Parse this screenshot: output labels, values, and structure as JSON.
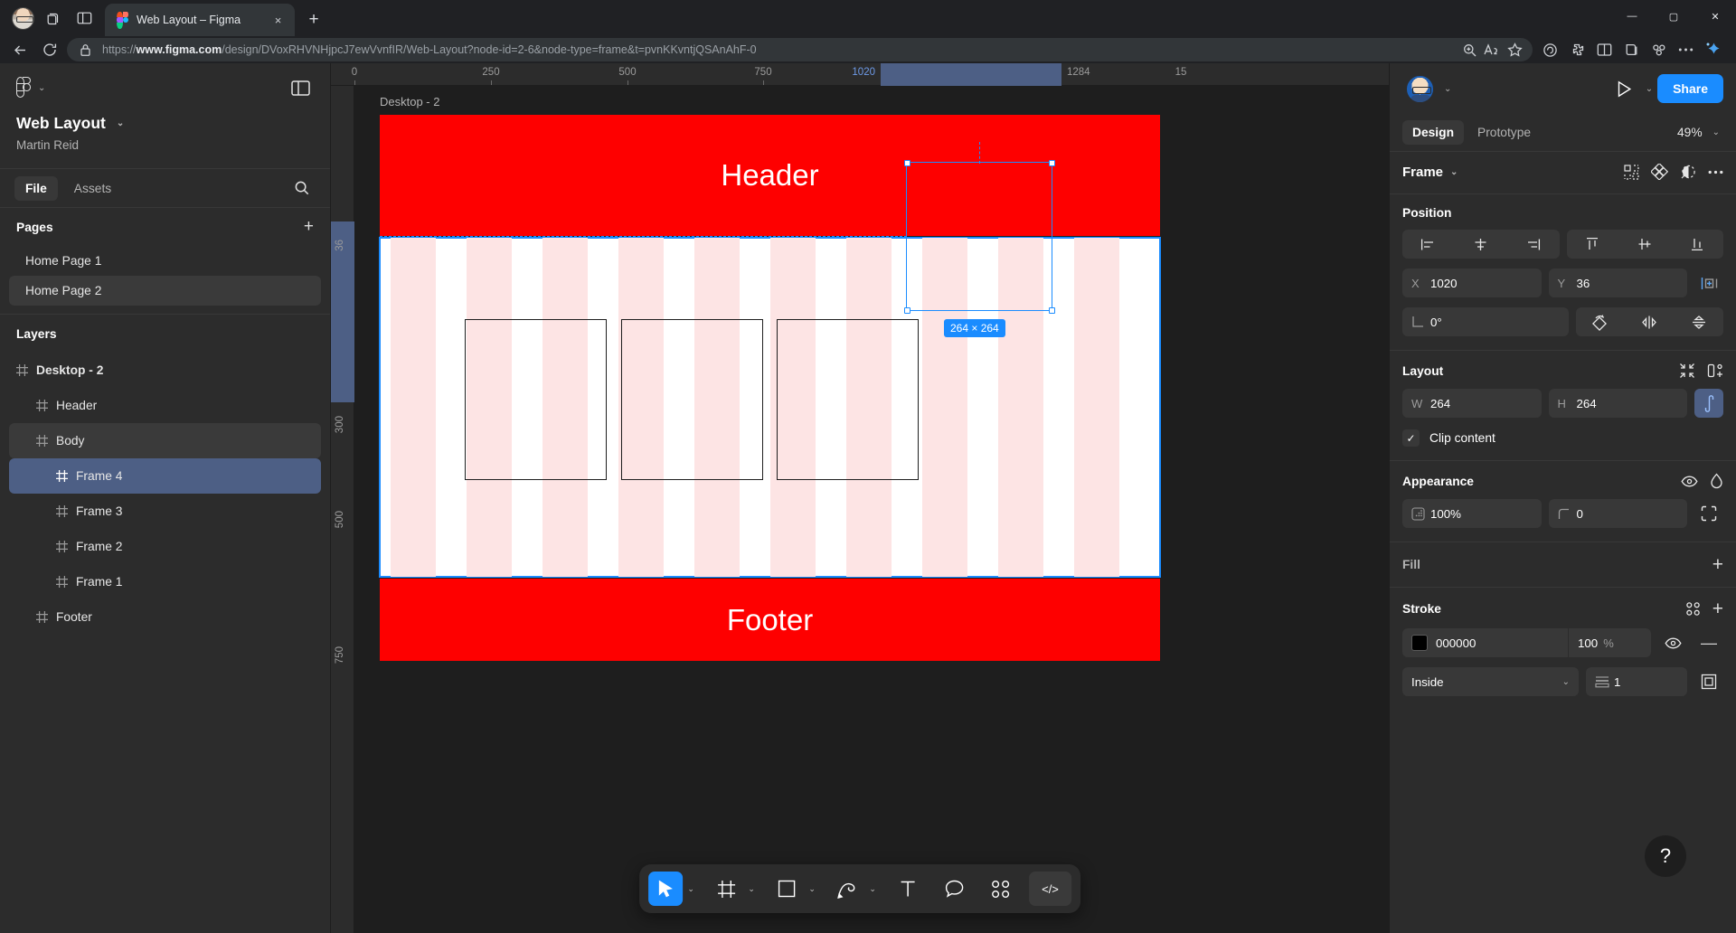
{
  "browser": {
    "tab": {
      "title": "Web Layout – Figma",
      "favicon": "figma-logo-icon",
      "close": "×"
    },
    "new_tab_label": "+",
    "window_controls": {
      "minimize": "—",
      "maximize": "▢",
      "close": "✕"
    },
    "address": {
      "url_prefix": "https://",
      "url_domain": "www.figma.com",
      "url_path": "/design/DVoxRHVNHjpcJ7ewVvnfIR/Web-Layout?node-id=2-6&node-type=frame&t=pvnKKvntjQSAnAhF-0",
      "lock_icon": "lock-icon"
    },
    "toolbar_icons": [
      "back-icon",
      "reload-icon",
      "zoom-icon",
      "read-aloud-icon",
      "favorite-icon",
      "collections-icon",
      "extensions-icon",
      "split-screen-icon",
      "browser-essentials-icon",
      "settings-more-icon",
      "copilot-icon"
    ]
  },
  "left_panel": {
    "file_name": "Web Layout",
    "file_owner": "Martin Reid",
    "tabs": [
      {
        "label": "File",
        "active": true
      },
      {
        "label": "Assets",
        "active": false
      }
    ],
    "search_icon": "search-icon",
    "pages_section": {
      "title": "Pages",
      "add_label": "+"
    },
    "pages": [
      {
        "label": "Home Page 1",
        "active": false
      },
      {
        "label": "Home Page 2",
        "active": true
      }
    ],
    "layers_section": {
      "title": "Layers"
    },
    "layers": [
      {
        "label": "Desktop - 2",
        "depth": 0,
        "state": "none",
        "bold": true
      },
      {
        "label": "Header",
        "depth": 1,
        "state": "none",
        "bold": false
      },
      {
        "label": "Body",
        "depth": 1,
        "state": "hovered",
        "bold": false
      },
      {
        "label": "Frame 4",
        "depth": 2,
        "state": "selected",
        "bold": false
      },
      {
        "label": "Frame 3",
        "depth": 2,
        "state": "none",
        "bold": false
      },
      {
        "label": "Frame 2",
        "depth": 2,
        "state": "none",
        "bold": false
      },
      {
        "label": "Frame 1",
        "depth": 2,
        "state": "none",
        "bold": false
      },
      {
        "label": "Footer",
        "depth": 1,
        "state": "none",
        "bold": false
      }
    ]
  },
  "canvas": {
    "frame_label": "Desktop - 2",
    "ruler_h": [
      {
        "label": "0",
        "pos": 0,
        "highlight": false
      },
      {
        "label": "250",
        "pos": 250,
        "highlight": false
      },
      {
        "label": "500",
        "pos": 500,
        "highlight": false
      },
      {
        "label": "750",
        "pos": 750,
        "highlight": false
      },
      {
        "label": "1020",
        "pos": 1020,
        "highlight": true
      },
      {
        "label": "1284",
        "pos": 1284,
        "highlight": false
      },
      {
        "label": "15",
        "pos": 1540,
        "highlight": false
      }
    ],
    "ruler_v": [
      {
        "label": "36",
        "pos": 36
      },
      {
        "label": "300",
        "pos": 300
      },
      {
        "label": "500",
        "pos": 500
      },
      {
        "label": "750",
        "pos": 750
      }
    ],
    "header_text": "Header",
    "footer_text": "Footer",
    "selection_badge": "264 × 264",
    "header_fill": "#fe0000",
    "footer_fill": "#fe0000",
    "grid_color": "#fde4e4",
    "selection_color": "#1a8cff"
  },
  "toolbar": {
    "tools": [
      {
        "name": "move-tool",
        "active": true,
        "has_caret": true
      },
      {
        "name": "frame-tool",
        "active": false,
        "has_caret": true
      },
      {
        "name": "shape-tool",
        "active": false,
        "has_caret": true
      },
      {
        "name": "pen-tool",
        "active": false,
        "has_caret": true
      },
      {
        "name": "text-tool",
        "active": false,
        "has_caret": false
      },
      {
        "name": "comment-tool",
        "active": false,
        "has_caret": false
      },
      {
        "name": "actions-tool",
        "active": false,
        "has_caret": false
      }
    ],
    "dev_mode_label": "</>"
  },
  "right_panel": {
    "avatar": "user-avatar",
    "present_icon": "present-play-icon",
    "share_label": "Share",
    "tabs": [
      {
        "label": "Design",
        "active": true
      },
      {
        "label": "Prototype",
        "active": false
      }
    ],
    "zoom_level": "49%",
    "object_type": "Frame",
    "object_icons": [
      "components-icon",
      "variants-icon",
      "mask-icon",
      "more-options-icon"
    ],
    "position": {
      "title": "Position",
      "align_icons": [
        "align-left-icon",
        "align-horizontal-center-icon",
        "align-right-icon",
        "align-top-icon",
        "align-vertical-center-icon",
        "align-bottom-icon"
      ],
      "x_label": "X",
      "x_value": "1020",
      "y_label": "Y",
      "y_value": "36",
      "rotation_label": "rotation-icon",
      "rotation_value": "0°",
      "extra_icons": [
        "distribute-icon",
        "corner-radius-independent-icon",
        "flip-horizontal-icon",
        "flip-vertical-icon"
      ]
    },
    "layout": {
      "title": "Layout",
      "icons": [
        "resize-to-fit-icon",
        "add-auto-layout-icon"
      ],
      "w_label": "W",
      "w_value": "264",
      "h_label": "H",
      "h_value": "264",
      "aspect_lock": "aspect-ratio-lock-icon",
      "clip_content_label": "Clip content",
      "clip_content_checked": true
    },
    "appearance": {
      "title": "Appearance",
      "icons": [
        "visibility-icon",
        "blend-mode-icon"
      ],
      "opacity_value": "100%",
      "opacity_icon": "opacity-icon",
      "corner_radius_value": "0",
      "corner_radius_icon": "corner-radius-icon",
      "independent_corners_icon": "independent-corners-icon"
    },
    "fill": {
      "title": "Fill",
      "add_label": "+"
    },
    "stroke": {
      "title": "Stroke",
      "style_icon": "stroke-style-icon",
      "add_label": "+",
      "color_hex": "000000",
      "color_swatch": "#000000",
      "opacity_value": "100",
      "opacity_unit": "%",
      "visibility_icon": "visibility-icon",
      "remove_label": "—",
      "align_value": "Inside",
      "weight_value": "1",
      "weight_icon": "stroke-weight-icon",
      "advanced_icon": "advanced-stroke-icon"
    },
    "help_label": "?"
  }
}
